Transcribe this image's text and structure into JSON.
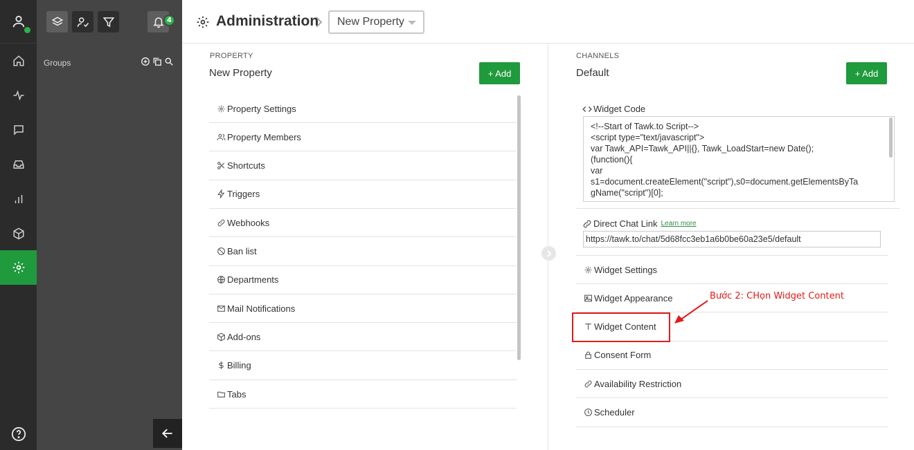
{
  "rail": {
    "items": [
      {
        "icon": "home-icon"
      },
      {
        "icon": "activity-icon"
      },
      {
        "icon": "chat-icon"
      },
      {
        "icon": "inbox-icon"
      },
      {
        "icon": "reports-icon"
      },
      {
        "icon": "cube-icon"
      },
      {
        "icon": "settings-icon",
        "active": true
      }
    ],
    "help_icon": "help-icon"
  },
  "groups": {
    "label": "Groups",
    "notification_count": "4"
  },
  "header": {
    "title": "Administration",
    "property_select": "New Property"
  },
  "property": {
    "section_label": "PROPERTY",
    "name": "New Property",
    "add_label": "+ Add",
    "items": [
      {
        "label": "Property Settings",
        "icon": "gear-icon"
      },
      {
        "label": "Property Members",
        "icon": "users-icon"
      },
      {
        "label": "Shortcuts",
        "icon": "scissors-icon"
      },
      {
        "label": "Triggers",
        "icon": "bolt-icon"
      },
      {
        "label": "Webhooks",
        "icon": "link-icon"
      },
      {
        "label": "Ban list",
        "icon": "ban-icon"
      },
      {
        "label": "Departments",
        "icon": "globe-icon"
      },
      {
        "label": "Mail Notifications",
        "icon": "mail-icon"
      },
      {
        "label": "Add-ons",
        "icon": "box-icon"
      },
      {
        "label": "Billing",
        "icon": "dollar-icon"
      },
      {
        "label": "Tabs",
        "icon": "folder-icon"
      }
    ]
  },
  "channels": {
    "section_label": "CHANNELS",
    "name": "Default",
    "add_label": "+ Add",
    "widget_code_label": "Widget Code",
    "widget_code_lines": [
      "<!--Start of Tawk.to Script-->",
      "<script type=\"text/javascript\">",
      "var Tawk_API=Tawk_API||{}, Tawk_LoadStart=new Date();",
      "(function(){",
      "var",
      "s1=document.createElement(\"script\"),s0=document.getElementsByTa",
      "gName(\"script\")[0];"
    ],
    "direct_chat_label": "Direct Chat Link",
    "learn_more": "Learn more",
    "direct_chat_url": "https://tawk.to/chat/5d68fcc3eb1a6b0be60a23e5/default",
    "items": [
      {
        "label": "Widget Settings",
        "icon": "gear-icon"
      },
      {
        "label": "Widget Appearance",
        "icon": "image-icon"
      },
      {
        "label": "Widget Content",
        "icon": "text-icon"
      },
      {
        "label": "Consent Form",
        "icon": "lock-icon"
      },
      {
        "label": "Availability Restriction",
        "icon": "link-icon"
      },
      {
        "label": "Scheduler",
        "icon": "clock-icon"
      }
    ]
  },
  "annotation": {
    "text": "Bước 2: CHọn Widget Content",
    "color": "#e31a1a"
  },
  "colors": {
    "accent": "#1f9a3d",
    "rail_bg": "#2b2b2b",
    "groups_bg": "#454545"
  }
}
